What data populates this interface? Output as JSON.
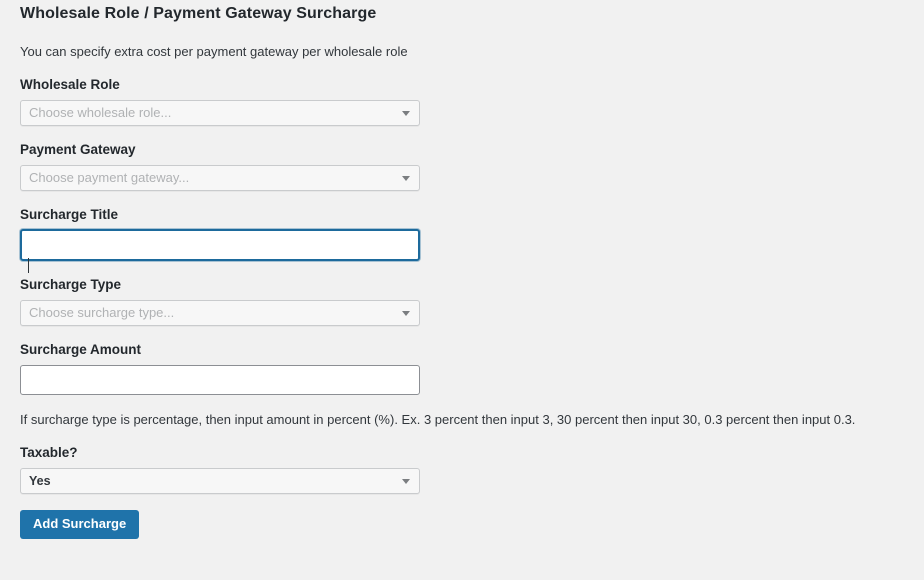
{
  "header": {
    "title": "Wholesale Role / Payment Gateway Surcharge",
    "description": "You can specify extra cost per payment gateway per wholesale role"
  },
  "form": {
    "wholesale_role": {
      "label": "Wholesale Role",
      "value": "",
      "placeholder": "Choose wholesale role...",
      "caret_icon": "chevron-down-icon"
    },
    "payment_gateway": {
      "label": "Payment Gateway",
      "value": "",
      "placeholder": "Choose payment gateway...",
      "caret_icon": "chevron-down-icon"
    },
    "surcharge_title": {
      "label": "Surcharge Title",
      "value": "",
      "placeholder": ""
    },
    "surcharge_type": {
      "label": "Surcharge Type",
      "value": "",
      "placeholder": "Choose surcharge type...",
      "caret_icon": "chevron-down-icon"
    },
    "surcharge_amount": {
      "label": "Surcharge Amount",
      "value": "",
      "placeholder": "",
      "help": "If surcharge type is percentage, then input amount in percent (%). Ex. 3 percent then input 3, 30 percent then input 30, 0.3 percent then input 0.3."
    },
    "taxable": {
      "label": "Taxable?",
      "value": "Yes",
      "caret_icon": "chevron-down-icon"
    },
    "submit": {
      "label": "Add Surcharge"
    }
  },
  "colors": {
    "page_background": "#f1f1f1",
    "primary_button": "#1f73aa",
    "focus_border": "#1d6a9c",
    "title_text": "#23282d",
    "placeholder_text": "#b0b2b4",
    "input_border": "#8c8f94"
  }
}
